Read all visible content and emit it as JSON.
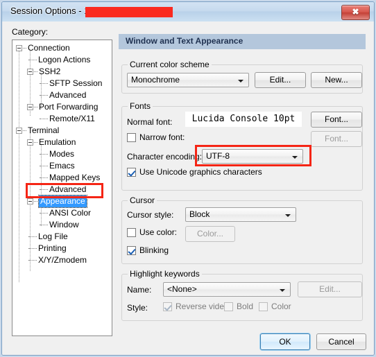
{
  "window": {
    "title_prefix": "Session Options - 1",
    "redacted": true,
    "close_icon": "close-icon",
    "close_glyph": "✖"
  },
  "sidebar": {
    "label": "Category:",
    "items": [
      {
        "label": "Connection",
        "depth": 0,
        "expander": "minus"
      },
      {
        "label": "Logon Actions",
        "depth": 1,
        "expander": "none"
      },
      {
        "label": "SSH2",
        "depth": 1,
        "expander": "minus"
      },
      {
        "label": "SFTP Session",
        "depth": 2,
        "expander": "none"
      },
      {
        "label": "Advanced",
        "depth": 2,
        "expander": "none"
      },
      {
        "label": "Port Forwarding",
        "depth": 1,
        "expander": "minus"
      },
      {
        "label": "Remote/X11",
        "depth": 2,
        "expander": "none"
      },
      {
        "label": "Terminal",
        "depth": 0,
        "expander": "minus"
      },
      {
        "label": "Emulation",
        "depth": 1,
        "expander": "minus"
      },
      {
        "label": "Modes",
        "depth": 2,
        "expander": "none"
      },
      {
        "label": "Emacs",
        "depth": 2,
        "expander": "none"
      },
      {
        "label": "Mapped Keys",
        "depth": 2,
        "expander": "none"
      },
      {
        "label": "Advanced",
        "depth": 2,
        "expander": "none"
      },
      {
        "label": "Appearance",
        "depth": 1,
        "expander": "minus",
        "selected": true
      },
      {
        "label": "ANSI Color",
        "depth": 2,
        "expander": "none"
      },
      {
        "label": "Window",
        "depth": 2,
        "expander": "none"
      },
      {
        "label": "Log File",
        "depth": 1,
        "expander": "none"
      },
      {
        "label": "Printing",
        "depth": 1,
        "expander": "none"
      },
      {
        "label": "X/Y/Zmodem",
        "depth": 1,
        "expander": "none"
      }
    ]
  },
  "pane": {
    "header": "Window and Text Appearance",
    "color_scheme": {
      "group_title": "Current color scheme",
      "value": "Monochrome",
      "edit_button": "Edit...",
      "new_button": "New..."
    },
    "fonts": {
      "group_title": "Fonts",
      "normal_font_label": "Normal font:",
      "normal_font_value": "Lucida Console 10pt",
      "normal_font_button": "Font...",
      "narrow_font_label": "Narrow font:",
      "narrow_font_checked": false,
      "narrow_font_button": "Font...",
      "encoding_label": "Character encoding:",
      "encoding_value": "UTF-8",
      "unicode_graphics_label": "Use Unicode graphics characters",
      "unicode_graphics_checked": true
    },
    "cursor": {
      "group_title": "Cursor",
      "style_label": "Cursor style:",
      "style_value": "Block",
      "use_color_label": "Use color:",
      "use_color_checked": false,
      "color_button": "Color...",
      "blinking_label": "Blinking",
      "blinking_checked": true
    },
    "highlight": {
      "group_title": "Highlight keywords",
      "name_label": "Name:",
      "name_value": "<None>",
      "edit_button": "Edit...",
      "style_label": "Style:",
      "reverse_video_label": "Reverse video",
      "reverse_video_checked": true,
      "bold_label": "Bold",
      "bold_checked": false,
      "color_label": "Color",
      "color_checked": false
    }
  },
  "footer": {
    "ok_button": "OK",
    "cancel_button": "Cancel"
  },
  "colors": {
    "annotation": "#f52515",
    "selection": "#3399ff",
    "pane_header": "#b4c7dc",
    "close_button": "#d6564c"
  }
}
